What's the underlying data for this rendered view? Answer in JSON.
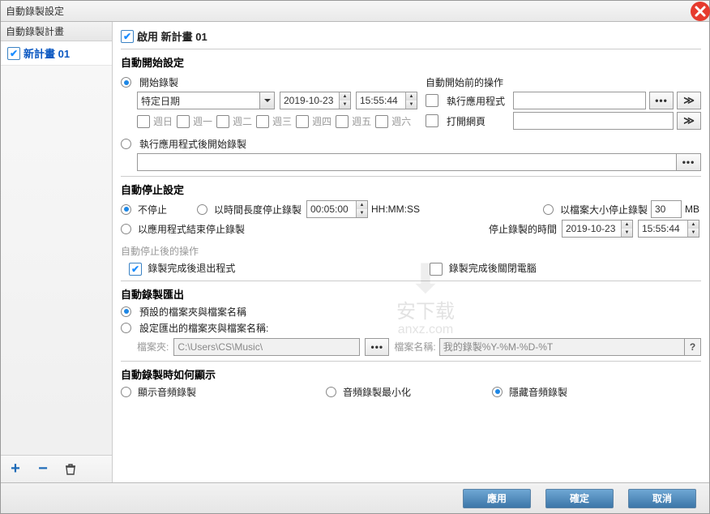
{
  "title": "自動錄製設定",
  "sidebar": {
    "header": "自動錄製計畫",
    "items": [
      "新計畫 01"
    ]
  },
  "enable": {
    "label": "啟用 新計畫 01"
  },
  "autostart": {
    "title": "自動開始設定",
    "start_recording": "開始錄製",
    "date_mode": "特定日期",
    "date": "2019-10-23",
    "time": "15:55:44",
    "weekdays": [
      "週日",
      "週一",
      "週二",
      "週三",
      "週四",
      "週五",
      "週六"
    ],
    "start_after_app": "執行應用程式後開始錄製",
    "pre_op": {
      "title": "自動開始前的操作",
      "run_app": "執行應用程式",
      "open_web": "打開網頁"
    }
  },
  "autostop": {
    "title": "自動停止設定",
    "no_stop": "不停止",
    "by_length": "以時間長度停止錄製",
    "length_value": "00:05:00",
    "length_hint": "HH:MM:SS",
    "by_size": "以檔案大小停止錄製",
    "size_value": "30",
    "size_unit": "MB",
    "by_app_end": "以應用程式結束停止錄製",
    "stop_time_label": "停止錄製的時間",
    "stop_date": "2019-10-23",
    "stop_time": "15:55:44",
    "after_stop_title": "自動停止後的操作",
    "quit_after": "錄製完成後退出程式",
    "shutdown_after": "錄製完成後關閉電腦"
  },
  "export": {
    "title": "自動錄製匯出",
    "default_opt": "預設的檔案夾與檔案名稱",
    "custom_opt": "設定匯出的檔案夾與檔案名稱:",
    "folder_label": "檔案夾:",
    "folder_value": "C:\\Users\\CS\\Music\\",
    "filename_label": "檔案名稱:",
    "filename_value": "我的錄製%Y-%M-%D-%T"
  },
  "display": {
    "title": "自動錄製時如何顯示",
    "show": "顯示音頻錄製",
    "minimize": "音頻錄製最小化",
    "hide": "隱藏音頻錄製"
  },
  "buttons": {
    "apply": "應用",
    "ok": "確定",
    "cancel": "取消"
  }
}
